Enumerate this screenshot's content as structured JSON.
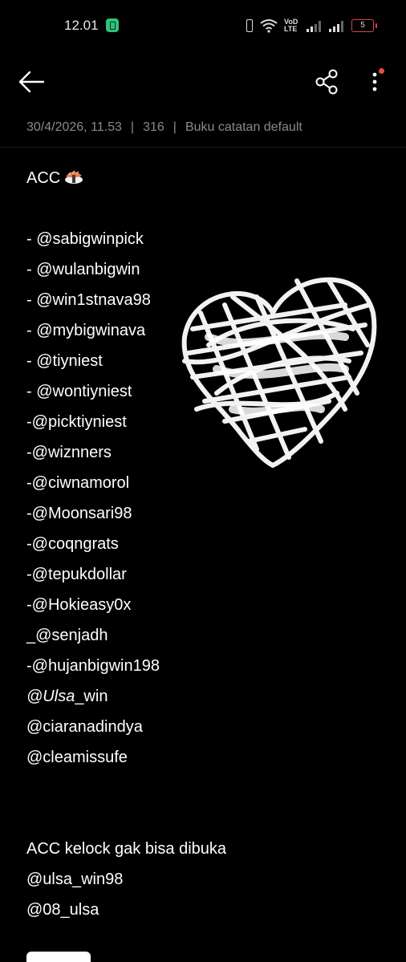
{
  "status_bar": {
    "time": "12.01",
    "volte": "VoD LTE",
    "battery_level": "5"
  },
  "toolbar": {
    "back": "back",
    "share": "share",
    "more": "more"
  },
  "meta": {
    "date": "30/4/2026, 11.53",
    "count": "316",
    "notebook": "Buku catatan default"
  },
  "note": {
    "lines": [
      {
        "text": " ACC",
        "emoji": "sushi-icon"
      },
      {
        "text": ""
      },
      {
        "text": "- @sabigwinpick"
      },
      {
        "text": "- @wulanbigwin"
      },
      {
        "text": "- @win1stnava98"
      },
      {
        "text": "- @mybigwinava"
      },
      {
        "text": "- @tiyniest"
      },
      {
        "text": "- @wontiyniest"
      },
      {
        "text": "-@picktiyniest"
      },
      {
        "text": "-@wiznners"
      },
      {
        "text": "-@ciwnamorol"
      },
      {
        "text": "-@Moonsari98"
      },
      {
        "text": "-@coqngrats"
      },
      {
        "text": "-@tepukdollar"
      },
      {
        "text": "-@Hokieasy0x"
      },
      {
        "text": "_@senjadh"
      },
      {
        "text": "-@hujanbigwin198"
      },
      {
        "text": "@Ulsa_win",
        "italic": "@Ulsa"
      },
      {
        "text": "@ciaranadindya"
      },
      {
        "text": "@cleamissufe"
      },
      {
        "text": ""
      },
      {
        "text": ""
      },
      {
        "text": "ACC kelock gak bisa dibuka"
      },
      {
        "text": "@ulsa_win98"
      },
      {
        "text": "@08_ulsa"
      }
    ]
  },
  "colors": {
    "background": "#000000",
    "text": "#ffffff",
    "meta": "#8a8a8a",
    "notification_dot": "#e94d3e"
  }
}
